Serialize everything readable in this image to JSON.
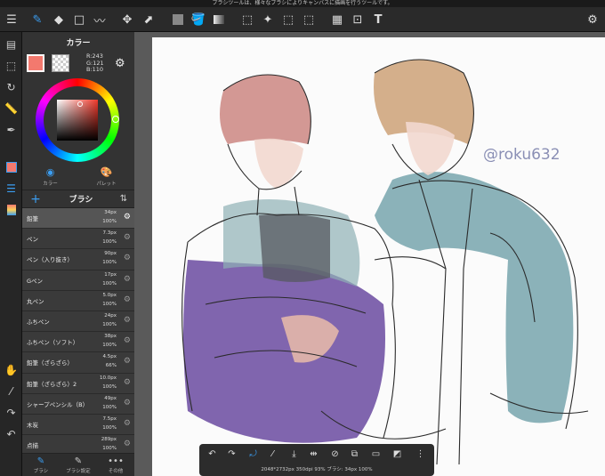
{
  "statusbar": {
    "message": "ブラシツールは、様々なブラシによりキャンバスに描画を行うツールです。"
  },
  "toolbar": {
    "icons": [
      "menu-icon",
      "brush-tool-icon",
      "eraser-icon",
      "rectangle-icon",
      "smudge-icon",
      "move-icon",
      "transform-icon",
      "fill-color-icon",
      "bucket-icon",
      "gradient-icon",
      "select-rect-icon",
      "magic-wand-icon",
      "select-pen-icon",
      "select-eraser-icon",
      "filter-icon",
      "crop-icon",
      "text-icon",
      "more-icon"
    ]
  },
  "color_panel": {
    "title": "カラー",
    "main_color": "#f3796e",
    "r": "R:243",
    "g": "G:121",
    "b": "B:110",
    "tab_color": "カラー",
    "tab_palette": "パレット"
  },
  "brush_panel": {
    "title": "ブラシ",
    "items": [
      {
        "name": "鉛筆",
        "size": "34px",
        "opacity": "100%"
      },
      {
        "name": "ペン",
        "size": "7.3px",
        "opacity": "100%"
      },
      {
        "name": "ペン（入り抜き）",
        "size": "90px",
        "opacity": "100%"
      },
      {
        "name": "Gペン",
        "size": "17px",
        "opacity": "100%"
      },
      {
        "name": "丸ペン",
        "size": "5.0px",
        "opacity": "100%"
      },
      {
        "name": "ふちペン",
        "size": "24px",
        "opacity": "100%"
      },
      {
        "name": "ふちペン（ソフト）",
        "size": "38px",
        "opacity": "100%"
      },
      {
        "name": "鉛筆（ざらざら）",
        "size": "4.5px",
        "opacity": "66%"
      },
      {
        "name": "鉛筆（ざらざら）2",
        "size": "10.0px",
        "opacity": "100%"
      },
      {
        "name": "シャープペンシル（B）",
        "size": "49px",
        "opacity": "100%"
      },
      {
        "name": "木炭",
        "size": "7.5px",
        "opacity": "100%"
      },
      {
        "name": "点描",
        "size": "289px",
        "opacity": "100%"
      }
    ],
    "bottom_tabs": [
      "ブラシ",
      "ブラシ設定",
      "その他"
    ]
  },
  "canvas": {
    "signature": "@roku632",
    "info": "2048*2732px 350dpi 93% ブラシ: 34px 100%"
  }
}
